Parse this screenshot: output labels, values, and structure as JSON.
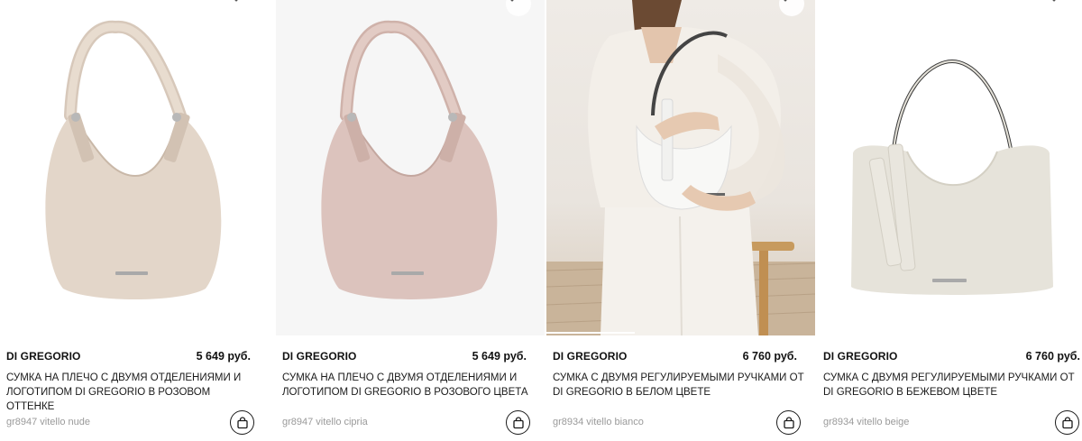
{
  "products": [
    {
      "brand": "DI GREGORIO",
      "price": "5 649 руб.",
      "title": "СУМКА НА ПЛЕЧО С ДВУМЯ ОТДЕЛЕНИЯМИ И ЛОГОТИПОМ DI GREGORIO В РОЗОВОМ ОТТЕНКЕ",
      "sku": "gr8947 vitello nude",
      "bag_color": "#e2d5c8"
    },
    {
      "brand": "DI GREGORIO",
      "price": "5 649 руб.",
      "title": "СУМКА НА ПЛЕЧО С ДВУМЯ ОТДЕЛЕНИЯМИ И ЛОГОТИПОМ DI GREGORIO В РОЗОВОГО ЦВЕТА",
      "sku": "gr8947 vitello cipria",
      "bag_color": "#dcc3bd"
    },
    {
      "brand": "DI GREGORIO",
      "price": "6 760 руб.",
      "title": "СУМКА С ДВУМЯ РЕГУЛИРУЕМЫМИ РУЧКАМИ ОТ DI GREGORIO В БЕЛОМ ЦВЕТЕ",
      "sku": "gr8934 vitello bianco",
      "bag_color": "#f7f7f5"
    },
    {
      "brand": "DI GREGORIO",
      "price": "6 760 руб.",
      "title": "СУМКА С ДВУМЯ РЕГУЛИРУЕМЫМИ РУЧКАМИ ОТ DI GREGORIO В БЕЖЕВОМ ЦВЕТЕ",
      "sku": "gr8934 vitello beige",
      "bag_color": "#e6e3da"
    }
  ],
  "icons": {
    "favorite": "heart-icon",
    "cart": "shopping-bag-icon"
  }
}
